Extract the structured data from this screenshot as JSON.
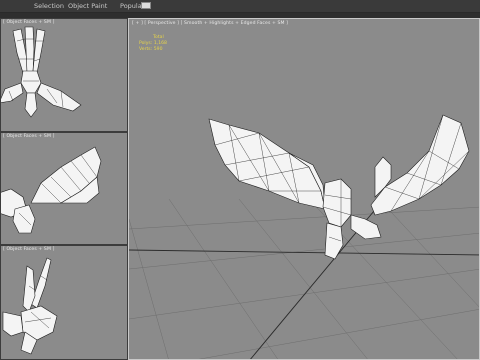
{
  "menu": {
    "items": [
      "Selection",
      "Object Paint",
      "Populate"
    ]
  },
  "viewports": {
    "top": {
      "label": "[ Object Faces + SM ]"
    },
    "front": {
      "label": "[ Object Faces + SM ]"
    },
    "left": {
      "label": "[ Object Faces + SM ]"
    },
    "perspective": {
      "label": "[ + ] [ Perspective ] [ Smooth + Highlights + Edged Faces + SM ]",
      "stats": {
        "total_label": "Total",
        "polys_label": "Polys:",
        "polys_value": "1,168",
        "verts_label": "Verts:",
        "verts_value": "590"
      }
    }
  },
  "colors": {
    "viewport_bg": "#8b8b8b",
    "stats_text": "#e6d34a",
    "mesh_fill": "#f4f4f4",
    "mesh_edge": "#1e1e1e"
  }
}
